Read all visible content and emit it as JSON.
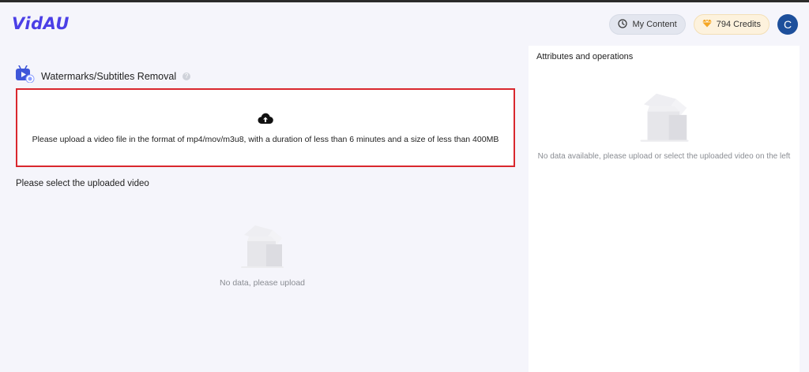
{
  "app": {
    "logo_text": "VidAU"
  },
  "header": {
    "my_content_label": "My Content",
    "credits_label": "794 Credits",
    "avatar_initial": "C",
    "clock_icon": "clock-icon",
    "gem_icon": "gem-icon"
  },
  "tool": {
    "title": "Watermarks/Subtitles Removal",
    "help_glyph": "?"
  },
  "upload": {
    "icon": "cloud-upload-icon",
    "instructions": "Please upload a video file in the format of mp4/mov/m3u8, with a duration of less than 6 minutes and a size of less than 400MB"
  },
  "uploaded_videos": {
    "label": "Please select the uploaded video",
    "empty_text": "No data, please upload"
  },
  "attributes": {
    "title": "Attributes and operations",
    "empty_text": "No data available, please upload or select the uploaded video on the left"
  },
  "colors": {
    "brand": "#4b3fe6",
    "upload_border": "#d9272e",
    "avatar": "#1d4f9b",
    "credits_bg": "#fdf2dd"
  }
}
